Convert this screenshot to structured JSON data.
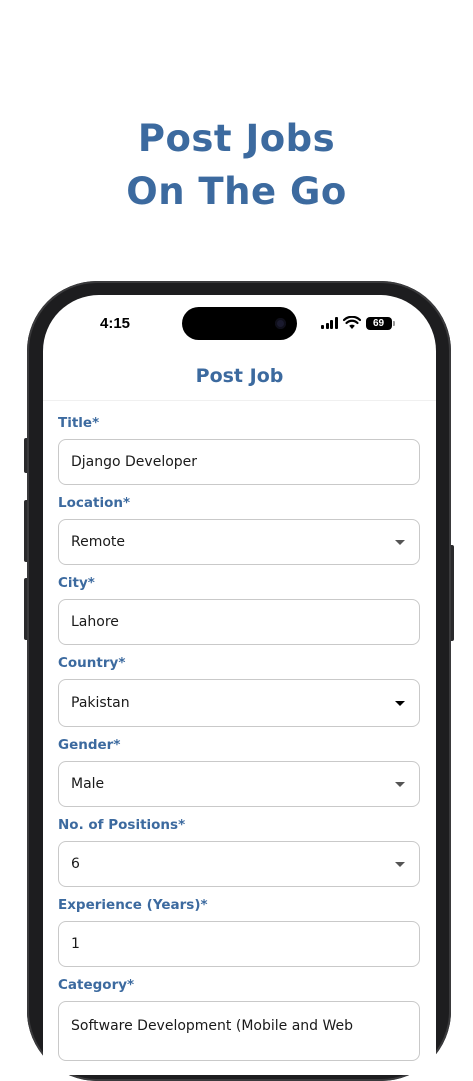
{
  "hero": {
    "line1": "Post Jobs",
    "line2": "On The Go"
  },
  "status_bar": {
    "time": "4:15",
    "battery": "69"
  },
  "app_bar": {
    "title": "Post Job"
  },
  "form": {
    "title": {
      "label": "Title*",
      "value": "Django Developer"
    },
    "location": {
      "label": "Location*",
      "value": "Remote"
    },
    "city": {
      "label": "City*",
      "value": "Lahore"
    },
    "country": {
      "label": "Country*",
      "value": "Pakistan"
    },
    "gender": {
      "label": "Gender*",
      "value": "Male"
    },
    "positions": {
      "label": "No. of Positions*",
      "value": "6"
    },
    "experience": {
      "label": "Experience (Years)*",
      "value": "1"
    },
    "category": {
      "label": "Category*",
      "value": "Software Development (Mobile and Web"
    }
  },
  "colors": {
    "accent": "#3c6a9f",
    "border": "#c9c9c9"
  }
}
